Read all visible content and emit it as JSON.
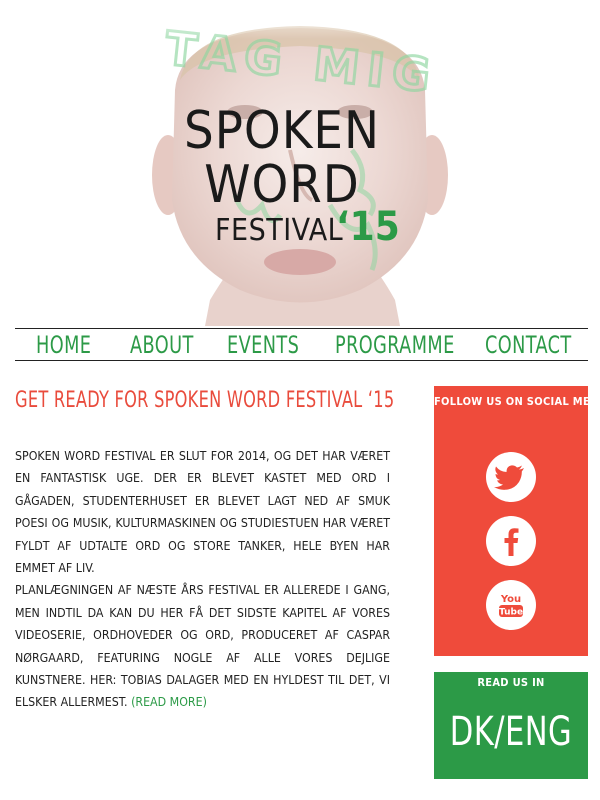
{
  "hero": {
    "logo_line1": "SPOKEN",
    "logo_line2": "WORD",
    "logo_line3": "FESTIVAL",
    "logo_year": "‘15",
    "overlay_text": "TAG MIG"
  },
  "nav": {
    "items": [
      {
        "label": "HOME"
      },
      {
        "label": "ABOUT"
      },
      {
        "label": "EVENTS"
      },
      {
        "label": "PROGRAMME"
      },
      {
        "label": "CONTACT"
      }
    ]
  },
  "article": {
    "headline": "GET READY FOR SPOKEN WORD FESTIVAL ‘15",
    "paragraph1": "Spoken Word Festival er slut for 2014, og det har været en fantastisk uge. Der er blevet kastet med ord i gågaden, Studenterhuset er blevet lagt ned af smuk poesi og musik, Kulturmaskinen og Studiestuen har været fyldt af udtalte ord og store tanker, hele byen har emmet af liv.",
    "paragraph2": "Planlægningen af næste års festival er allerede i gang, men indtil da kan du her få det sidste kapitel af vores videoserie, Ordhoveder og Ord, produceret af Caspar Nørgaard, featuring nogle af alle vores dejlige kunstnere. Her: Tobias Dalager med en hyldest til det, vi elsker allermest.",
    "read_more": "(READ MORE)"
  },
  "sidebar": {
    "social_title": "FOLLOW US ON SOCIAL MEDIA",
    "social_icons": [
      "twitter-icon",
      "facebook-icon",
      "youtube-icon"
    ],
    "youtube_label_1": "You",
    "youtube_label_2": "Tube",
    "lang_title": "READ US IN",
    "lang_options": "DK/ENG"
  },
  "colors": {
    "green": "#2c9a47",
    "red": "#ef4b3b",
    "headline_red": "#e94b3c",
    "text": "#222222"
  }
}
